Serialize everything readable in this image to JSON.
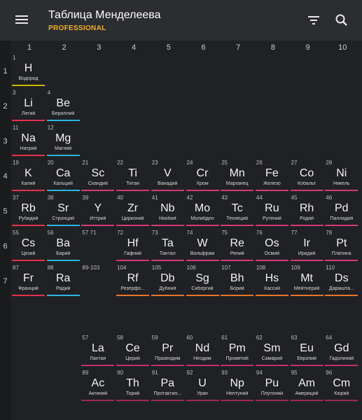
{
  "app": {
    "title": "Таблица Менделеева",
    "subtitle": "PROFESSIONAL"
  },
  "icons": {
    "menu": "menu-icon",
    "filter": "filter-icon",
    "search": "search-icon"
  },
  "colors": {
    "nonmetal": "#c8b400",
    "alkali": "#e0324a",
    "alkaline": "#29b6e6",
    "transition": "#d23a78",
    "post_transition": "#e8742a",
    "lanthanide": "#c0306e",
    "actinide": "#a0285c"
  },
  "column_headers": [
    "1",
    "2",
    "3",
    "4",
    "5",
    "6",
    "7",
    "8",
    "9",
    "10"
  ],
  "row_headers": [
    "1",
    "2",
    "3",
    "4",
    "5",
    "6",
    "7"
  ],
  "gap_labels": [
    "57 71",
    "89-103"
  ],
  "elements": [
    {
      "n": "1",
      "s": "H",
      "name": "Водород",
      "col": 1,
      "row": 1,
      "cat": "nonmetal"
    },
    {
      "n": "3",
      "s": "Li",
      "name": "Литий",
      "col": 1,
      "row": 2,
      "cat": "alkali"
    },
    {
      "n": "4",
      "s": "Be",
      "name": "Бериллий",
      "col": 2,
      "row": 2,
      "cat": "alkaline"
    },
    {
      "n": "11",
      "s": "Na",
      "name": "Натрий",
      "col": 1,
      "row": 3,
      "cat": "alkali"
    },
    {
      "n": "12",
      "s": "Mg",
      "name": "Магний",
      "col": 2,
      "row": 3,
      "cat": "alkaline"
    },
    {
      "n": "19",
      "s": "K",
      "name": "Калий",
      "col": 1,
      "row": 4,
      "cat": "alkali"
    },
    {
      "n": "20",
      "s": "Ca",
      "name": "Кальций",
      "col": 2,
      "row": 4,
      "cat": "alkaline"
    },
    {
      "n": "21",
      "s": "Sc",
      "name": "Скандий",
      "col": 3,
      "row": 4,
      "cat": "transition"
    },
    {
      "n": "22",
      "s": "Ti",
      "name": "Титан",
      "col": 4,
      "row": 4,
      "cat": "transition"
    },
    {
      "n": "23",
      "s": "V",
      "name": "Ванадий",
      "col": 5,
      "row": 4,
      "cat": "transition"
    },
    {
      "n": "24",
      "s": "Cr",
      "name": "Хром",
      "col": 6,
      "row": 4,
      "cat": "transition"
    },
    {
      "n": "25",
      "s": "Mn",
      "name": "Марганец",
      "col": 7,
      "row": 4,
      "cat": "transition"
    },
    {
      "n": "26",
      "s": "Fe",
      "name": "Железо",
      "col": 8,
      "row": 4,
      "cat": "transition"
    },
    {
      "n": "27",
      "s": "Co",
      "name": "Кобальт",
      "col": 9,
      "row": 4,
      "cat": "transition"
    },
    {
      "n": "28",
      "s": "Ni",
      "name": "Никель",
      "col": 10,
      "row": 4,
      "cat": "transition"
    },
    {
      "n": "37",
      "s": "Rb",
      "name": "Рубидий",
      "col": 1,
      "row": 5,
      "cat": "alkali"
    },
    {
      "n": "38",
      "s": "Sr",
      "name": "Стронций",
      "col": 2,
      "row": 5,
      "cat": "alkaline"
    },
    {
      "n": "39",
      "s": "Y",
      "name": "Иттрий",
      "col": 3,
      "row": 5,
      "cat": "transition"
    },
    {
      "n": "40",
      "s": "Zr",
      "name": "Цирконий",
      "col": 4,
      "row": 5,
      "cat": "transition"
    },
    {
      "n": "41",
      "s": "Nb",
      "name": "Ниобий",
      "col": 5,
      "row": 5,
      "cat": "transition"
    },
    {
      "n": "42",
      "s": "Mo",
      "name": "Молибден",
      "col": 6,
      "row": 5,
      "cat": "transition"
    },
    {
      "n": "43",
      "s": "Tc",
      "name": "Технеций",
      "col": 7,
      "row": 5,
      "cat": "transition"
    },
    {
      "n": "44",
      "s": "Ru",
      "name": "Рутений",
      "col": 8,
      "row": 5,
      "cat": "transition"
    },
    {
      "n": "45",
      "s": "Rh",
      "name": "Родий",
      "col": 9,
      "row": 5,
      "cat": "transition"
    },
    {
      "n": "46",
      "s": "Pd",
      "name": "Палладий",
      "col": 10,
      "row": 5,
      "cat": "transition"
    },
    {
      "n": "55",
      "s": "Cs",
      "name": "Цезий",
      "col": 1,
      "row": 6,
      "cat": "alkali"
    },
    {
      "n": "56",
      "s": "Ba",
      "name": "Барий",
      "col": 2,
      "row": 6,
      "cat": "alkaline"
    },
    {
      "n": "72",
      "s": "Hf",
      "name": "Гафний",
      "col": 4,
      "row": 6,
      "cat": "transition"
    },
    {
      "n": "73",
      "s": "Ta",
      "name": "Тантал",
      "col": 5,
      "row": 6,
      "cat": "transition"
    },
    {
      "n": "74",
      "s": "W",
      "name": "Вольфрам",
      "col": 6,
      "row": 6,
      "cat": "transition"
    },
    {
      "n": "75",
      "s": "Re",
      "name": "Рений",
      "col": 7,
      "row": 6,
      "cat": "transition"
    },
    {
      "n": "76",
      "s": "Os",
      "name": "Осмий",
      "col": 8,
      "row": 6,
      "cat": "transition"
    },
    {
      "n": "77",
      "s": "Ir",
      "name": "Иридий",
      "col": 9,
      "row": 6,
      "cat": "transition"
    },
    {
      "n": "78",
      "s": "Pt",
      "name": "Платина",
      "col": 10,
      "row": 6,
      "cat": "transition"
    },
    {
      "n": "87",
      "s": "Fr",
      "name": "Франций",
      "col": 1,
      "row": 7,
      "cat": "alkali"
    },
    {
      "n": "88",
      "s": "Ra",
      "name": "Радий",
      "col": 2,
      "row": 7,
      "cat": "alkaline"
    },
    {
      "n": "104",
      "s": "Rf",
      "name": "Резерфо...",
      "col": 4,
      "row": 7,
      "cat": "post_transition"
    },
    {
      "n": "105",
      "s": "Db",
      "name": "Дубний",
      "col": 5,
      "row": 7,
      "cat": "post_transition"
    },
    {
      "n": "106",
      "s": "Sg",
      "name": "Сиборгий",
      "col": 6,
      "row": 7,
      "cat": "post_transition"
    },
    {
      "n": "107",
      "s": "Bh",
      "name": "Борий",
      "col": 7,
      "row": 7,
      "cat": "post_transition"
    },
    {
      "n": "108",
      "s": "Hs",
      "name": "Хассий",
      "col": 8,
      "row": 7,
      "cat": "post_transition"
    },
    {
      "n": "109",
      "s": "Mt",
      "name": "Мейтнерий",
      "col": 9,
      "row": 7,
      "cat": "post_transition"
    },
    {
      "n": "110",
      "s": "Ds",
      "name": "Дармшта...",
      "col": 10,
      "row": 7,
      "cat": "post_transition"
    },
    {
      "n": "57",
      "s": "La",
      "name": "Лантан",
      "col": 3,
      "row": 9,
      "cat": "lanthanide"
    },
    {
      "n": "58",
      "s": "Ce",
      "name": "Церий",
      "col": 4,
      "row": 9,
      "cat": "lanthanide"
    },
    {
      "n": "59",
      "s": "Pr",
      "name": "Празеодим",
      "col": 5,
      "row": 9,
      "cat": "lanthanide"
    },
    {
      "n": "60",
      "s": "Nd",
      "name": "Неодим",
      "col": 6,
      "row": 9,
      "cat": "lanthanide"
    },
    {
      "n": "61",
      "s": "Pm",
      "name": "Прометий",
      "col": 7,
      "row": 9,
      "cat": "lanthanide"
    },
    {
      "n": "62",
      "s": "Sm",
      "name": "Самарий",
      "col": 8,
      "row": 9,
      "cat": "lanthanide"
    },
    {
      "n": "63",
      "s": "Eu",
      "name": "Европий",
      "col": 9,
      "row": 9,
      "cat": "lanthanide"
    },
    {
      "n": "64",
      "s": "Gd",
      "name": "Гадолиний",
      "col": 10,
      "row": 9,
      "cat": "lanthanide"
    },
    {
      "n": "89",
      "s": "Ac",
      "name": "Актиний",
      "col": 3,
      "row": 10,
      "cat": "actinide"
    },
    {
      "n": "90",
      "s": "Th",
      "name": "Торий",
      "col": 4,
      "row": 10,
      "cat": "actinide"
    },
    {
      "n": "91",
      "s": "Pa",
      "name": "Протактин...",
      "col": 5,
      "row": 10,
      "cat": "actinide"
    },
    {
      "n": "92",
      "s": "U",
      "name": "Уран",
      "col": 6,
      "row": 10,
      "cat": "actinide"
    },
    {
      "n": "93",
      "s": "Np",
      "name": "Нептуний",
      "col": 7,
      "row": 10,
      "cat": "actinide"
    },
    {
      "n": "94",
      "s": "Pu",
      "name": "Плутоний",
      "col": 8,
      "row": 10,
      "cat": "actinide"
    },
    {
      "n": "95",
      "s": "Am",
      "name": "Америций",
      "col": 9,
      "row": 10,
      "cat": "actinide"
    },
    {
      "n": "96",
      "s": "Cm",
      "name": "Кюрий",
      "col": 10,
      "row": 10,
      "cat": "actinide"
    }
  ]
}
